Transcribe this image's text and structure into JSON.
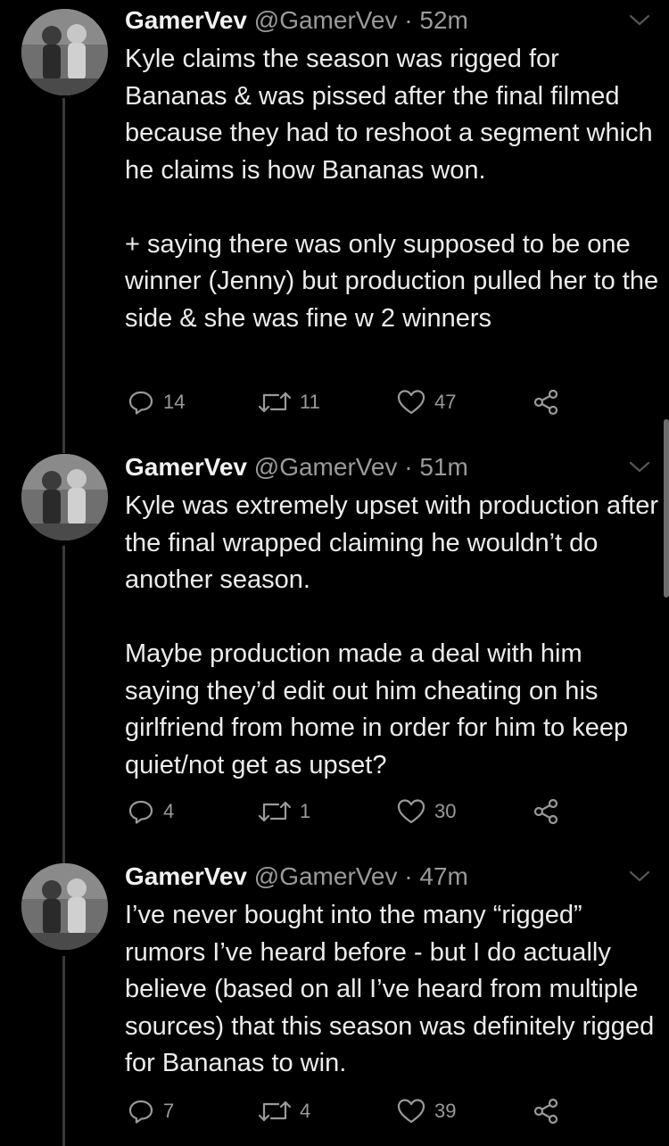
{
  "tweets": [
    {
      "name": "GamerVev",
      "handle": "@GamerVev",
      "separator": "·",
      "time": "52m",
      "paragraphs": [
        "Kyle claims the season was rigged for Bananas & was pissed after the final filmed because they had to reshoot a segment which he claims is how Bananas won.",
        "+ saying there was only supposed to be one winner (Jenny) but production pulled her to the side & she was fine w 2 winners"
      ],
      "replies": "14",
      "retweets": "11",
      "likes": "47"
    },
    {
      "name": "GamerVev",
      "handle": "@GamerVev",
      "separator": "·",
      "time": "51m",
      "paragraphs": [
        "Kyle was extremely upset with production after the final wrapped claiming he wouldn’t do another season.",
        "Maybe production made a deal with him saying they’d edit out him cheating on his girlfriend from home in order for him to keep quiet/not get as upset?"
      ],
      "replies": "4",
      "retweets": "1",
      "likes": "30"
    },
    {
      "name": "GamerVev",
      "handle": "@GamerVev",
      "separator": "·",
      "time": "47m",
      "paragraphs": [
        "I’ve never bought into the many “rigged” rumors I’ve heard before - but I do actually believe (based on all I’ve heard from multiple sources) that this season was definitely rigged for Bananas to win."
      ],
      "replies": "7",
      "retweets": "4",
      "likes": "39"
    }
  ],
  "icons": {
    "reply": "reply-icon",
    "retweet": "retweet-icon",
    "like": "heart-icon",
    "share": "share-icon",
    "menu": "chevron-down-icon"
  },
  "colors": {
    "background": "#000000",
    "text": "#ececec",
    "secondary": "#9a9a9a",
    "thread_line": "#3a3a3a"
  }
}
